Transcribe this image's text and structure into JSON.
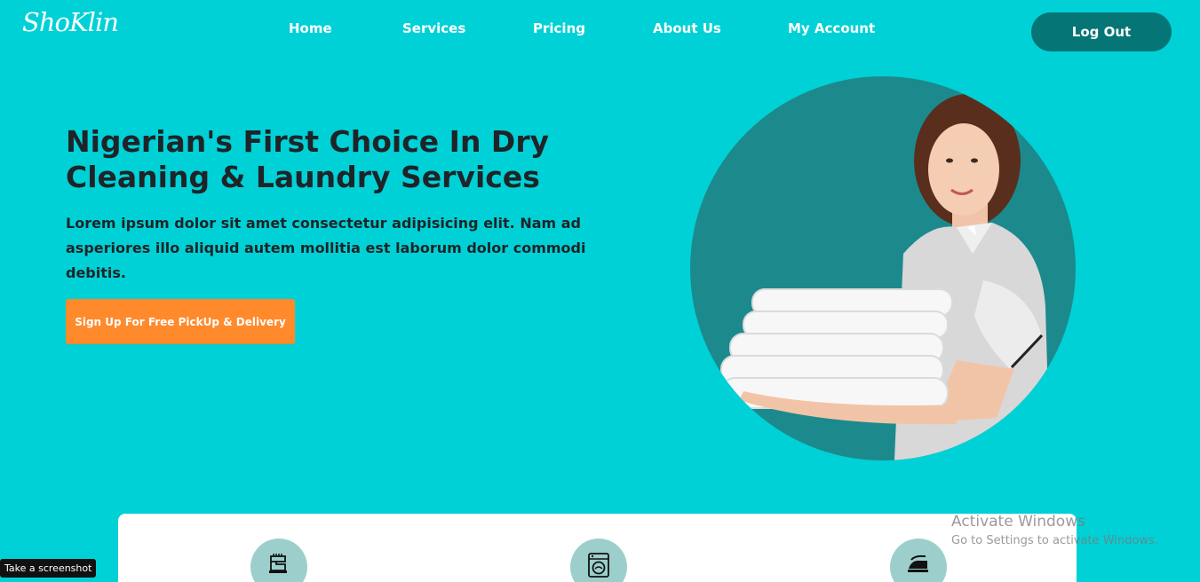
{
  "brand": {
    "logo_text": "ShoKlin"
  },
  "nav": {
    "items": [
      {
        "label": "Home"
      },
      {
        "label": "Services"
      },
      {
        "label": "Pricing"
      },
      {
        "label": "About Us"
      },
      {
        "label": "My Account"
      }
    ],
    "logout_label": "Log Out"
  },
  "hero": {
    "title": "Nigerian's First Choice In Dry Cleaning & Laundry Services",
    "text": "Lorem ipsum dolor sit amet consectetur adipisicing elit. Nam ad asperiores illo aliquid autem mollitia est laborum dolor commodi debitis.",
    "cta_label": "Sign Up For Free PickUp & Delivery"
  },
  "services": {
    "icons": [
      "sewing-machine-icon",
      "washing-machine-icon",
      "iron-icon"
    ]
  },
  "overlay": {
    "activate_title": "Activate Windows",
    "activate_sub": "Go to Settings to activate Windows.",
    "screenshot_label": "Take a screenshot"
  },
  "colors": {
    "background": "#00d1d6",
    "logout_button": "#067576",
    "cta_button": "#ff8a2c",
    "hero_circle": "#1c8a8d",
    "service_icon_bg": "#9ccfcc",
    "heading_text": "#1e2428"
  }
}
